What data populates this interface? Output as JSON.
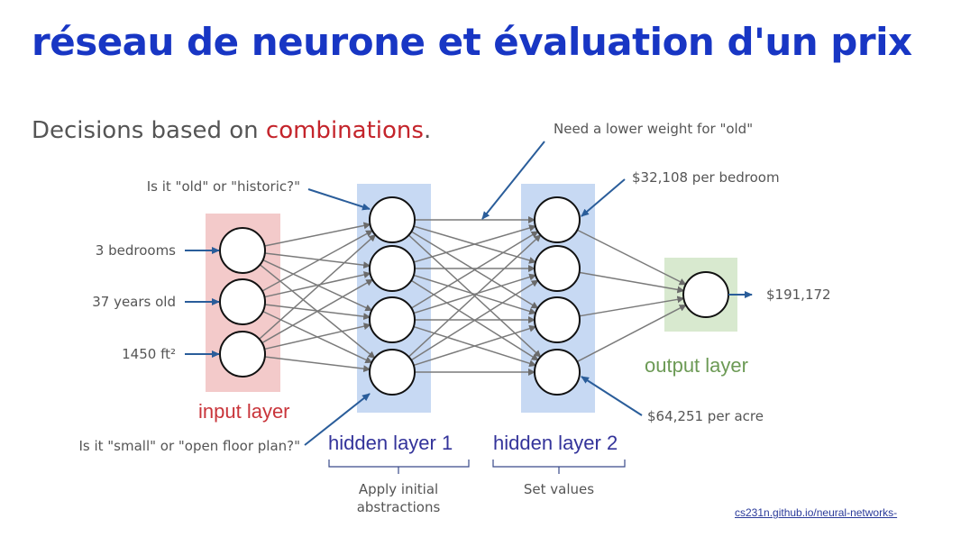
{
  "title": "réseau de neurone et évaluation d'un prix",
  "subtitle": {
    "prefix": "Decisions based on ",
    "highlight": "combinations",
    "suffix": "."
  },
  "inputs": [
    "3 bedrooms",
    "37 years old",
    "1450 ft²"
  ],
  "annotations": {
    "old_historic": "Is it \"old\" or \"historic?\"",
    "small_open": "Is it \"small\" or \"open floor plan?\"",
    "lower_weight": "Need a lower weight for \"old\"",
    "per_bedroom": "$32,108 per bedroom",
    "per_acre": "$64,251 per acre"
  },
  "output_value": "$191,172",
  "layers": {
    "input": "input layer",
    "hidden1": "hidden layer 1",
    "hidden2": "hidden layer 2",
    "output": "output layer"
  },
  "braces": {
    "hidden1_line1": "Apply initial",
    "hidden1_line2": "abstractions",
    "hidden2": "Set values"
  },
  "link": "cs231n.github.io/neural-networks-",
  "network": {
    "input_nodes": 3,
    "hidden1_nodes": 4,
    "hidden2_nodes": 4,
    "output_nodes": 1
  },
  "colors": {
    "title": "#1836c4",
    "highlight": "#c4242b",
    "input_bg": "#f3caca",
    "hidden_bg": "#c7d9f3",
    "output_bg": "#d8e9cf",
    "input_label": "#c9353b",
    "hidden_label": "#33339a",
    "output_label": "#6c9a55",
    "arrow": "#2a5d9a",
    "edge": "#7a7a7a"
  }
}
